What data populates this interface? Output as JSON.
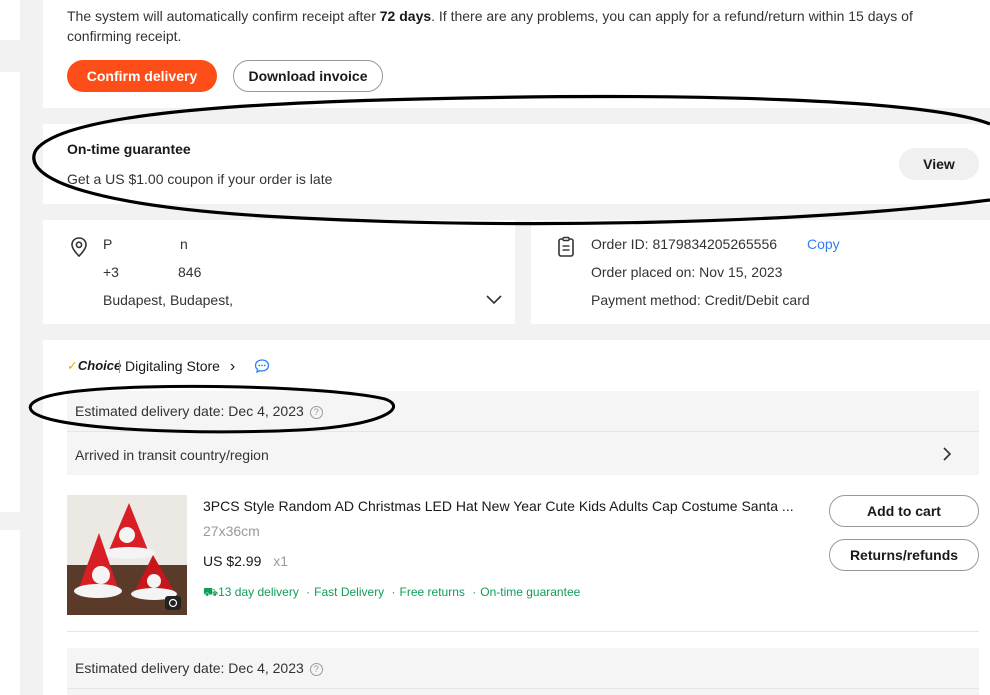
{
  "notice": {
    "text_before": "The system will automatically confirm receipt after ",
    "days": "72 days",
    "text_after": ". If there are any problems, you can apply for a refund/return within 15 days of confirming receipt."
  },
  "actions": {
    "confirm_label": "Confirm delivery",
    "download_label": "Download invoice"
  },
  "guarantee": {
    "title": "On-time guarantee",
    "description": "Get a US $1.00 coupon if your order is late",
    "view_label": "View"
  },
  "address": {
    "name_start": "P",
    "name_end": "n",
    "phone_start": "+3",
    "phone_end": "846",
    "city": "Budapest, Budapest,"
  },
  "order": {
    "id_label": "Order ID: 8179834205265556",
    "copy_label": "Copy",
    "placed_label": "Order placed on: Nov 15, 2023",
    "payment_label": "Payment method: Credit/Debit card"
  },
  "store": {
    "choice_badge": "Choice",
    "name": "Digitaling Store",
    "chevron": "›"
  },
  "delivery": {
    "estimated_1": "Estimated delivery date: Dec 4, 2023",
    "status": "Arrived in transit country/region",
    "estimated_2": "Estimated delivery date: Dec 4, 2023",
    "help_glyph": "?"
  },
  "product": {
    "title": "3PCS Style Random AD Christmas LED Hat New Year Cute Kids Adults Cap Costume Santa ...",
    "variant": "27x36cm",
    "price": "US $2.99",
    "qty": "x1",
    "tag_delivery": "13 day delivery",
    "tag_fast": "Fast Delivery",
    "tag_returns": "Free returns",
    "tag_guarantee": "On-time guarantee",
    "sep": "·",
    "add_to_cart_label": "Add to cart",
    "returns_label": "Returns/refunds"
  },
  "colors": {
    "accent": "#fd4d18",
    "link": "#2f7ef5",
    "green": "#0f9d58",
    "annotation": "#000000"
  }
}
